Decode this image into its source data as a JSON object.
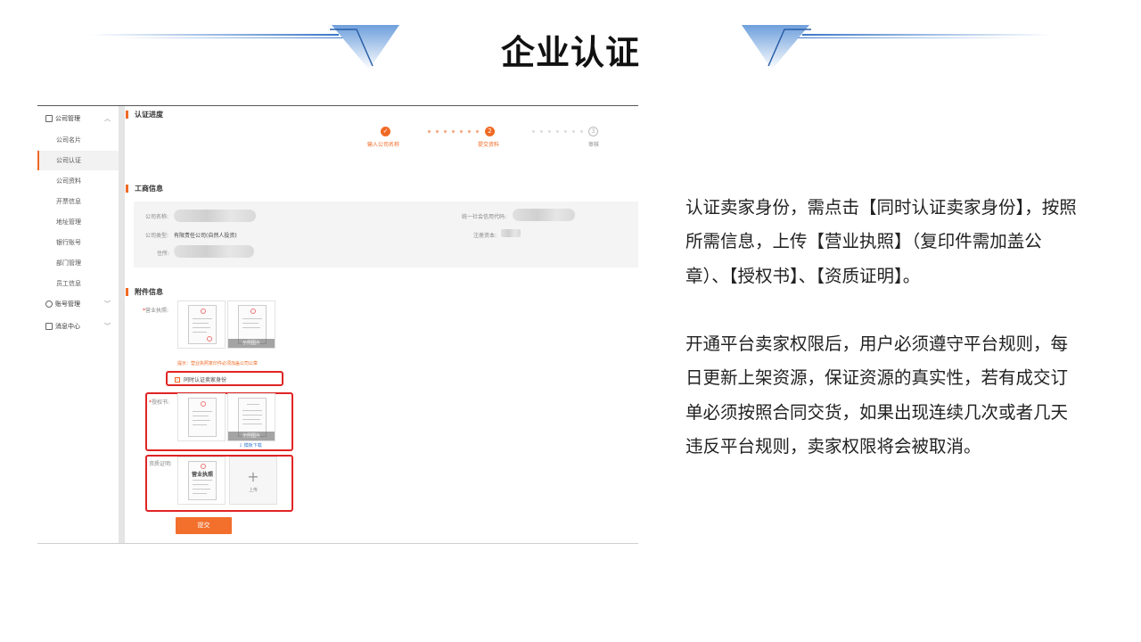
{
  "slide": {
    "title": "企业认证",
    "paragraphs": [
      "认证卖家身份，需点击【同时认证卖家身份】，按照所需信息，上传【营业执照】（复印件需加盖公章）、【授权书】、【资质证明】。",
      "开通平台卖家权限后，用户必须遵守平台规则，每日更新上架资源，保证资源的真实性，若有成交订单必须按照合同交货，如果出现连续几次或者几天违反平台规则，卖家权限将会被取消。"
    ]
  },
  "sidebar": {
    "company_mgmt": "公司管理",
    "items": [
      "公司名片",
      "公司认证",
      "公司资料",
      "开票信息",
      "地址管理",
      "银行账号",
      "部门管理",
      "员工信息"
    ],
    "account_mgmt": "账号管理",
    "message_center": "消息中心"
  },
  "progress": {
    "title": "认证进度",
    "steps": [
      {
        "num": "✓",
        "label": "输入公司名称"
      },
      {
        "num": "2",
        "label": "提交资料"
      },
      {
        "num": "3",
        "label": "审核"
      }
    ]
  },
  "business_info": {
    "title": "工商信息",
    "company_name_label": "公司名称:",
    "company_type_label": "公司类型:",
    "company_type_value": "有限责任公司(自然人投资)",
    "address_label": "住所:",
    "credit_code_label": "统一社会信用代码:",
    "capital_label": "注册资本:"
  },
  "attachments": {
    "title": "附件信息",
    "license_label": "营业执照:",
    "license_required": "*",
    "example_caption": "示例图片",
    "hint": "提示：营业执照复印件必须加盖公司公章",
    "checkbox_label": "同时认证卖家身份",
    "checkbox_checked": true,
    "auth_label": "授权书:",
    "auth_required": "*",
    "template_download": "模板下载",
    "qualification_label": "资质证明:",
    "doc_title": "营业执照",
    "upload_label": "上传",
    "submit": "提交"
  },
  "colors": {
    "accent": "#f06a25",
    "highlight_box": "#e02424",
    "link": "#3a7bd5"
  }
}
